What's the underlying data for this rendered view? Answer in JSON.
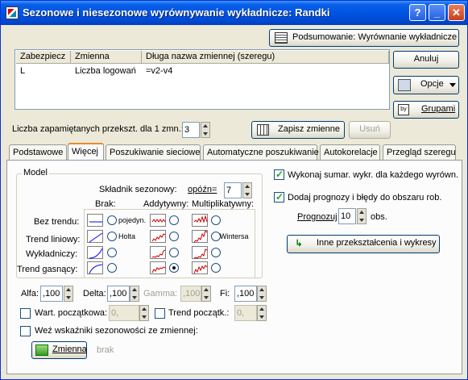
{
  "window": {
    "title": "Sezonowe i niesezonowe wyrównywanie wykładnicze: Randki"
  },
  "buttons": {
    "summary": "Podsumowanie: Wyrównanie wykładnicze",
    "cancel": "Anuluj",
    "options": "Opcje",
    "groups": "Grupami",
    "save_vars": "Zapisz zmienne",
    "delete": "Usuń",
    "other_transforms": "Inne przekształcenia i wykresy",
    "variable": "Zmienna"
  },
  "list": {
    "headers": [
      "Zabezpiecz",
      "Zmienna",
      "Długa nazwa zmiennej (szeregu)"
    ],
    "rows": [
      {
        "lock": "L",
        "name": "Liczba logowań",
        "long": "=v2-v4"
      }
    ]
  },
  "remembered": {
    "label": "Liczba zapamiętanych przekszt. dla 1 zmn.:",
    "value": "3"
  },
  "tabs": [
    "Podstawowe",
    "Więcej",
    "Poszukiwanie sieciowe",
    "Automatyczne poszukiwanie",
    "Autokorelacje",
    "Przegląd szeregu"
  ],
  "active_tab": "Więcej",
  "model": {
    "legend": "Model",
    "seasonal_label": "Składnik sezonowy:",
    "lag_label": "opóźn=",
    "lag_value": "7",
    "col_none": "Brak:",
    "col_add": "Addytywny:",
    "col_mult": "Multiplikatywny:",
    "rows": [
      "Bez trendu:",
      "Trend liniowy:",
      "Wykładniczy:",
      "Trend gasnący:"
    ],
    "tag_single": "pojedyn.",
    "tag_holt": "Holta",
    "tag_winters": "Wintersa"
  },
  "params": {
    "alfa_label": "Alfa:",
    "alfa": ",100",
    "delta_label": "Delta:",
    "delta": ",100",
    "gamma_label": "Gamma:",
    "gamma": ",100",
    "fi_label": "Fi:",
    "fi": ",100"
  },
  "init": {
    "label": "Wart. początkowa:",
    "value": "0,",
    "trend_label": "Trend początk.:",
    "trend_value": "0,"
  },
  "season_from_var": {
    "label": "Weź wskaźniki sezonowości ze zmiennej:",
    "none": "brak"
  },
  "right": {
    "sum_label": "Wykonaj sumar. wykr. dla każdego wyrówn.",
    "forecast_label": "Dodaj prognozy i błędy do obszaru rob.",
    "predict_label": "Prognozuj",
    "predict_value": "10",
    "obs_label": "obs."
  }
}
